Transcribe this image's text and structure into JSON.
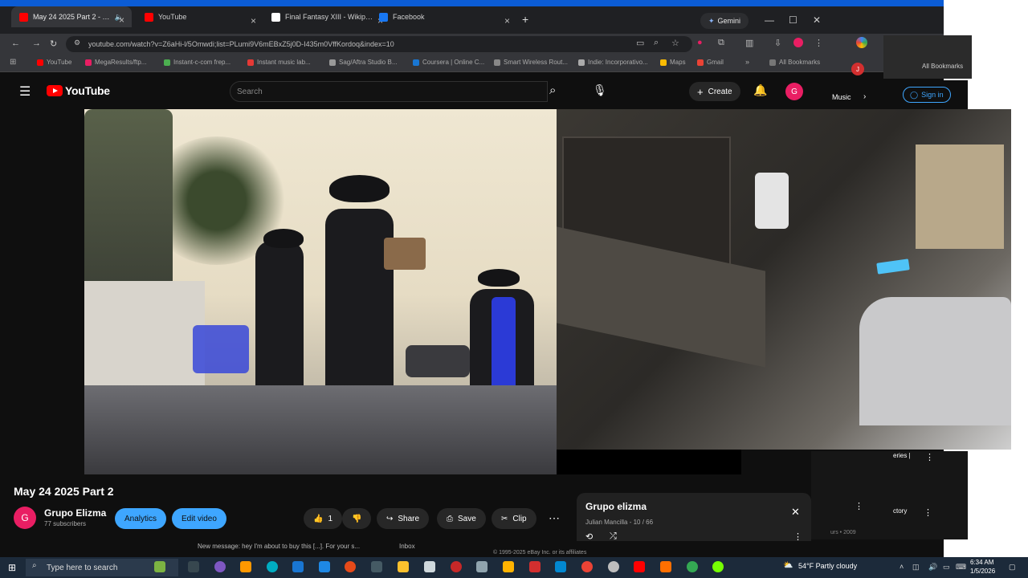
{
  "browser": {
    "tabs": [
      {
        "label": "May 24 2025 Part 2 - YouTu",
        "active": true,
        "favicon_color": "#ff0000"
      },
      {
        "label": "YouTube",
        "active": false,
        "favicon_color": "#ff0000"
      },
      {
        "label": "Final Fantasy XIII - Wikipedia",
        "active": false,
        "favicon_color": "#ffffff"
      },
      {
        "label": "Facebook",
        "active": false,
        "favicon_color": "#1877f2"
      }
    ],
    "new_tab": "+",
    "gemini_label": "Gemini",
    "url": "youtube.com/watch?v=Z6aHi-l/5Omwdi;list=PLumi9V6mEBxZ5j0D-I435m0VffKordoq&index=10",
    "bookmarks": [
      "YouTube",
      "MegaResults/ftp...",
      "Instant-c-com frep...",
      "Instant music lab...",
      "Sag/Aftra Studio B...",
      "Coursera | Online C...",
      "Smart Wireless Rout...",
      "Indie: Incorporativo...",
      "Maps",
      "Gmail",
      "All Bookmarks"
    ],
    "right_window_label": "All Bookmarks"
  },
  "youtube": {
    "logo_text": "YouTube",
    "search_placeholder": "Search",
    "create_label": "Create",
    "avatar_letter": "G",
    "music_chip": "Music",
    "sign_in": "Sign in"
  },
  "video": {
    "title": "May 24 2025 Part 2",
    "channel_name": "Grupo Elizma",
    "channel_initial": "G",
    "subscribers": "77 subscribers",
    "analytics_label": "Analytics",
    "edit_label": "Edit video",
    "like_count": "1",
    "share_label": "Share",
    "save_label": "Save",
    "clip_label": "Clip"
  },
  "playlist": {
    "title": "Grupo elizma",
    "subtitle": "Julian Mancilla - 10 / 66"
  },
  "sidebar": {
    "rec1": "eries |",
    "rec2": "ctory",
    "year": "urs • 2009"
  },
  "footer": {
    "notification": "New message: hey I'm about to buy this [...]. For your s...",
    "inbox": "Inbox",
    "copyright": "© 1995-2025 eBay Inc. or its affiliates"
  },
  "taskbar": {
    "search_placeholder": "Type here to search",
    "weather": "54°F  Partly cloudy",
    "time": "6:34 AM",
    "date": "1/5/2026"
  }
}
